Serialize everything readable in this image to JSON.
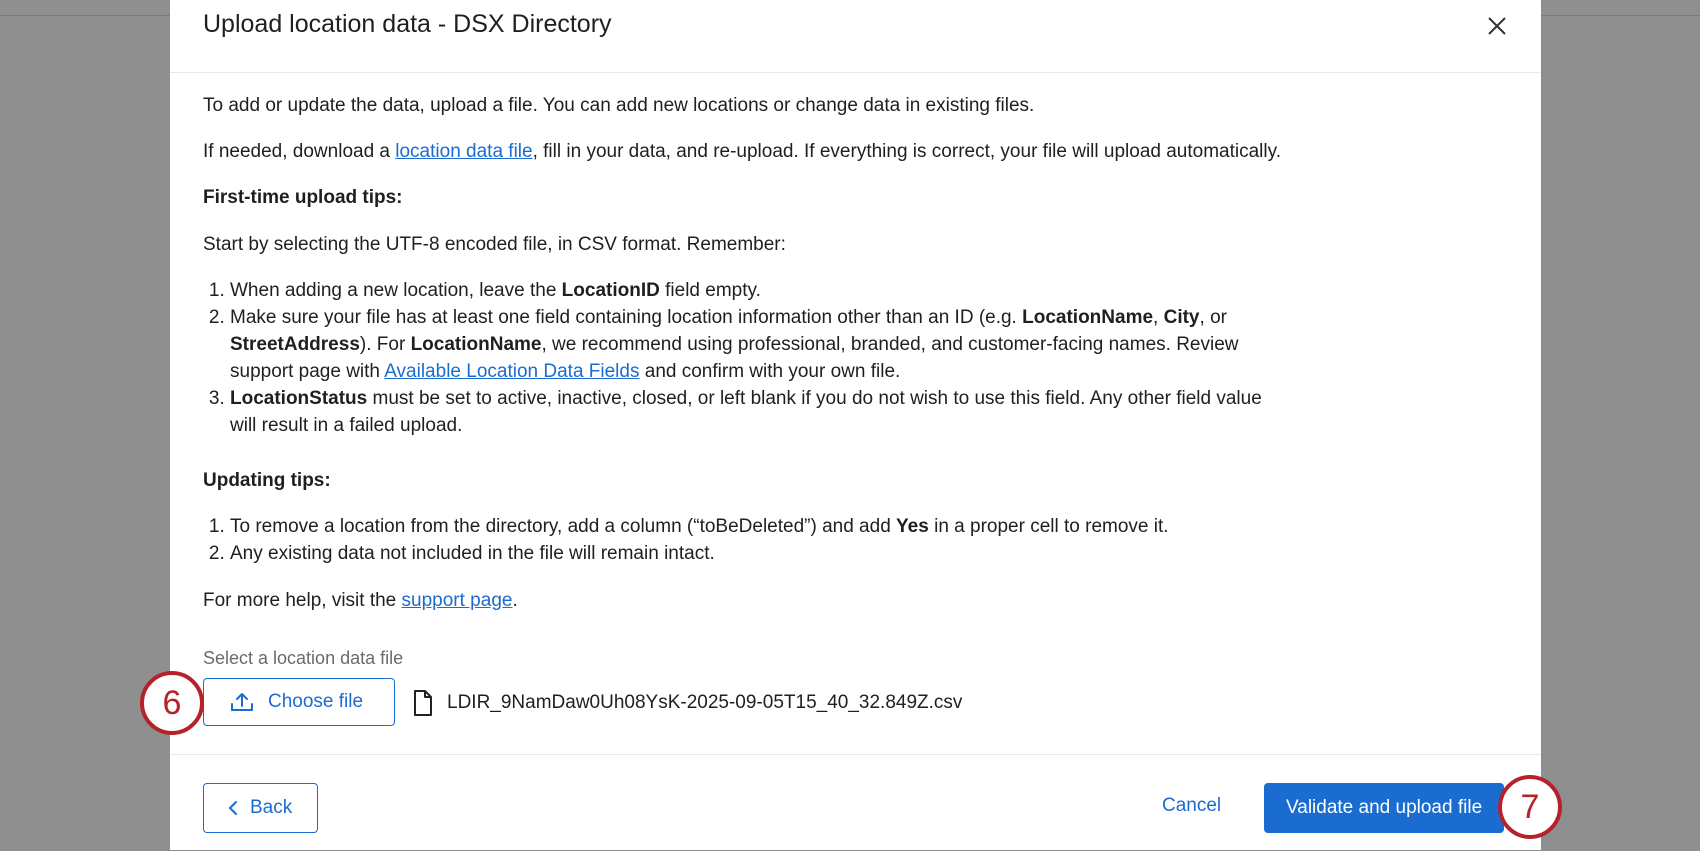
{
  "dialog": {
    "title": "Upload location data - DSX Directory"
  },
  "body": {
    "intro": "To add or update the data, upload a file. You can add new locations or change data in existing files.",
    "download_pre": "If needed, download a ",
    "download_link": "location data file",
    "download_post": ", fill in your data, and re-upload. If everything is correct, your file will upload automatically.",
    "first_time_heading": "First-time upload tips:",
    "first_time_intro": "Start by selecting the UTF-8 encoded file, in CSV format. Remember:",
    "tip1_pre": "When adding a new location, leave the ",
    "tip1_bold": "LocationID",
    "tip1_post": " field empty.",
    "tip2_a": "Make sure your file has at least one field containing location information other than an ID (e.g. ",
    "tip2_b1": "LocationName",
    "tip2_c": ", ",
    "tip2_b2": "City",
    "tip2_d": ", or ",
    "tip2_b3": "StreetAddress",
    "tip2_e": "). For ",
    "tip2_b4": "LocationName",
    "tip2_f": ", we recommend using professional, branded, and customer-facing names. Review support page with ",
    "tip2_link": "Available Location Data Fields",
    "tip2_g": " and confirm with your own file.",
    "tip3_bold": "LocationStatus",
    "tip3_post": " must be set to active, inactive, closed, or left blank if you do not wish to use this field. Any other field value will result in a failed upload.",
    "updating_heading": "Updating tips:",
    "upd1_pre": "To remove a location from the directory, add a column (“toBeDeleted”) and add ",
    "upd1_bold": "Yes",
    "upd1_post": " in a proper cell to remove it.",
    "upd2": "Any existing data not included in the file will remain intact.",
    "help_pre": "For more help, visit the ",
    "help_link": "support page",
    "help_post": ".",
    "file_label": "Select a location data file",
    "choose_label": "Choose file",
    "file_name": "LDIR_9NamDaw0Uh08YsK-2025-09-05T15_40_32.849Z.csv"
  },
  "footer": {
    "back_label": "Back",
    "cancel_label": "Cancel",
    "primary_label": "Validate and upload file"
  },
  "annotations": {
    "step6": "6",
    "step7": "7"
  },
  "colors": {
    "accent": "#1a6cd1",
    "badge": "#b5222b",
    "overlay": "#8f8f8f"
  }
}
